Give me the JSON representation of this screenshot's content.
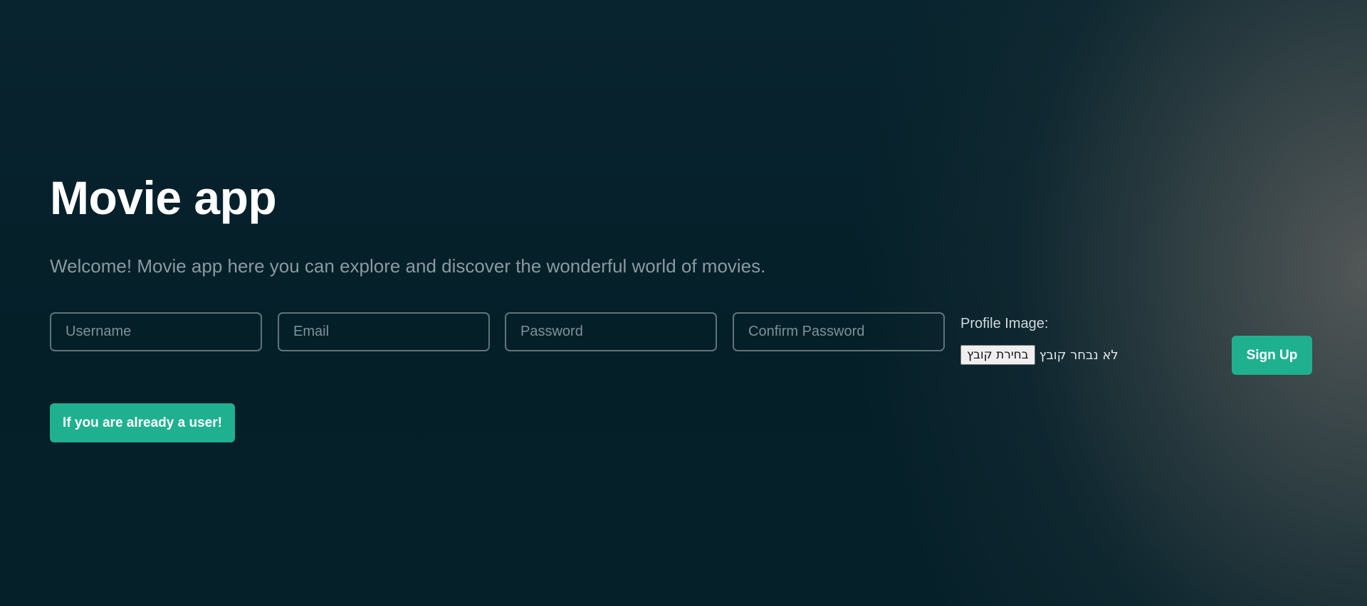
{
  "header": {
    "title": "Movie app",
    "subtitle": "Welcome! Movie app here you can explore and discover the wonderful world of movies."
  },
  "form": {
    "username_placeholder": "Username",
    "email_placeholder": "Email",
    "password_placeholder": "Password",
    "confirm_password_placeholder": "Confirm Password",
    "profile_image_label": "Profile Image:",
    "file_button_label": "בחירת קובץ",
    "file_status": "לא נבחר קובץ",
    "signup_label": "Sign Up"
  },
  "footer": {
    "already_user_label": "If you are already a user!"
  },
  "colors": {
    "accent": "#1fb08f",
    "background": "#051f29"
  }
}
